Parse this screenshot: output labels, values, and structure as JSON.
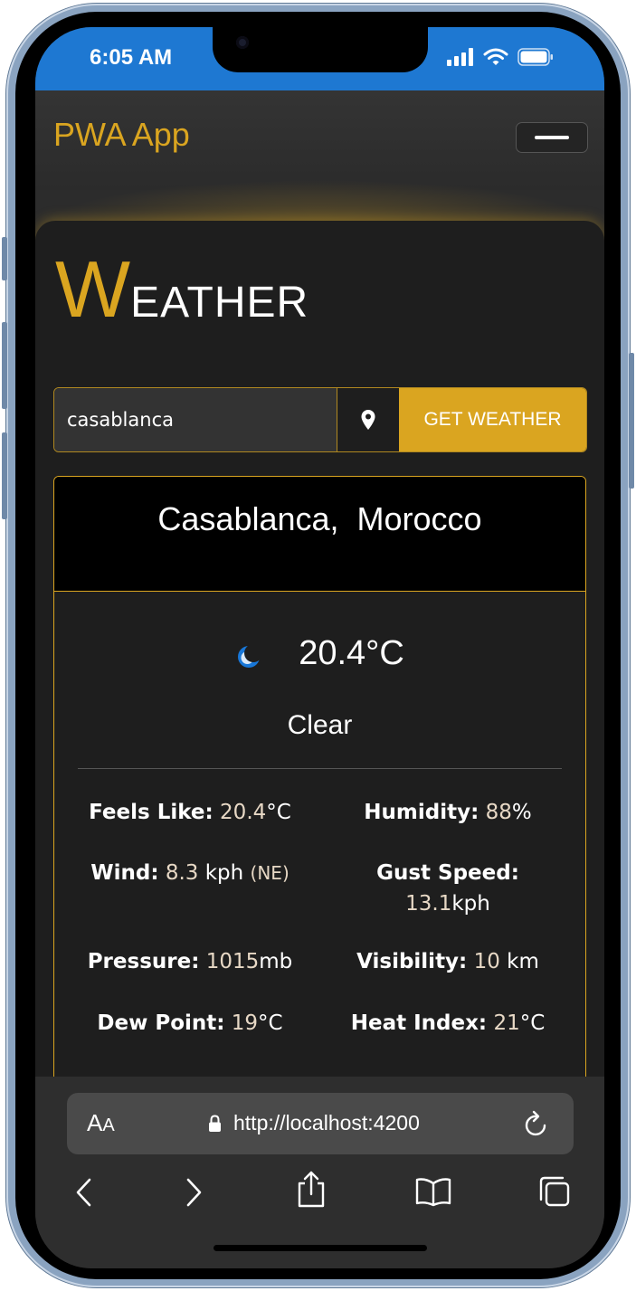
{
  "status_bar": {
    "time": "6:05 AM"
  },
  "app": {
    "title": "PWA App"
  },
  "weather_heading": {
    "first_letter": "W",
    "rest": "EATHER"
  },
  "search": {
    "value": "casablanca",
    "button_label": "GET WEATHER"
  },
  "result": {
    "location": "Casablanca,  Morocco",
    "temperature": "20.4°C",
    "condition": "Clear",
    "details": {
      "feels_like": {
        "label": "Feels Like:",
        "value": "20.4",
        "unit": "°C"
      },
      "humidity": {
        "label": "Humidity:",
        "value": "88",
        "unit": "%"
      },
      "wind": {
        "label": "Wind:",
        "value": "8.3",
        "unit": "kph",
        "direction": "(NE)"
      },
      "gust_speed": {
        "label": "Gust Speed:",
        "value": "13.1",
        "unit": "kph"
      },
      "pressure": {
        "label": "Pressure:",
        "value": "1015",
        "unit": "mb"
      },
      "visibility": {
        "label": "Visibility:",
        "value": "10",
        "unit": "km"
      },
      "dew_point": {
        "label": "Dew Point:",
        "value": "19",
        "unit": "°C"
      },
      "heat_index": {
        "label": "Heat Index:",
        "value": "21",
        "unit": "°C"
      }
    }
  },
  "browser": {
    "aa_large": "A",
    "aa_small": "A",
    "url": "http://localhost:4200"
  },
  "icons": {
    "location": "map-pin-icon",
    "weather": "moon-icon",
    "signal": "signal-icon",
    "wifi": "wifi-icon",
    "battery": "battery-icon",
    "lock": "lock-icon",
    "reload": "reload-icon",
    "back": "chevron-left-icon",
    "forward": "chevron-right-icon",
    "share": "share-icon",
    "bookmarks": "book-icon",
    "tabs": "tabs-icon"
  },
  "colors": {
    "accent": "#daa520",
    "status_bar": "#1e78d2",
    "background": "#1e1e1e"
  }
}
